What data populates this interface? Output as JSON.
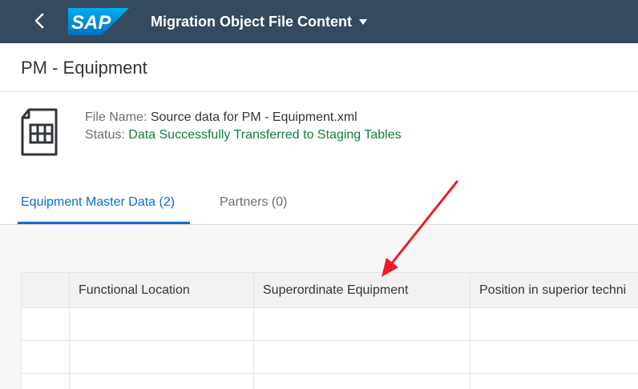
{
  "shell": {
    "logo_text": "SAP",
    "app_title": "Migration Object File Content"
  },
  "page": {
    "title": "PM - Equipment"
  },
  "file_info": {
    "file_name_label": "File Name:",
    "file_name_value": "Source data for PM - Equipment.xml",
    "status_label": "Status:",
    "status_value": "Data Successfully Transferred to Staging Tables"
  },
  "tabs": [
    {
      "label": "Equipment Master Data (2)",
      "selected": true
    },
    {
      "label": "Partners (0)",
      "selected": false
    }
  ],
  "table": {
    "columns": [
      "",
      "Functional Location",
      "Superordinate Equipment",
      "Position in superior techni"
    ],
    "rows": [
      [
        "",
        "",
        "",
        ""
      ],
      [
        "",
        "",
        "",
        ""
      ],
      [
        "",
        "",
        "",
        ""
      ]
    ]
  },
  "colors": {
    "shell_bg": "#354a5f",
    "logo_blue": "#0a6ed1",
    "accent": "#0a6ed1",
    "status_green": "#107e3e",
    "annotation_arrow": "#ee1c25"
  },
  "icons": {
    "back": "back-chevron-icon",
    "title_menu": "caret-down-icon",
    "file": "spreadsheet-file-icon"
  }
}
